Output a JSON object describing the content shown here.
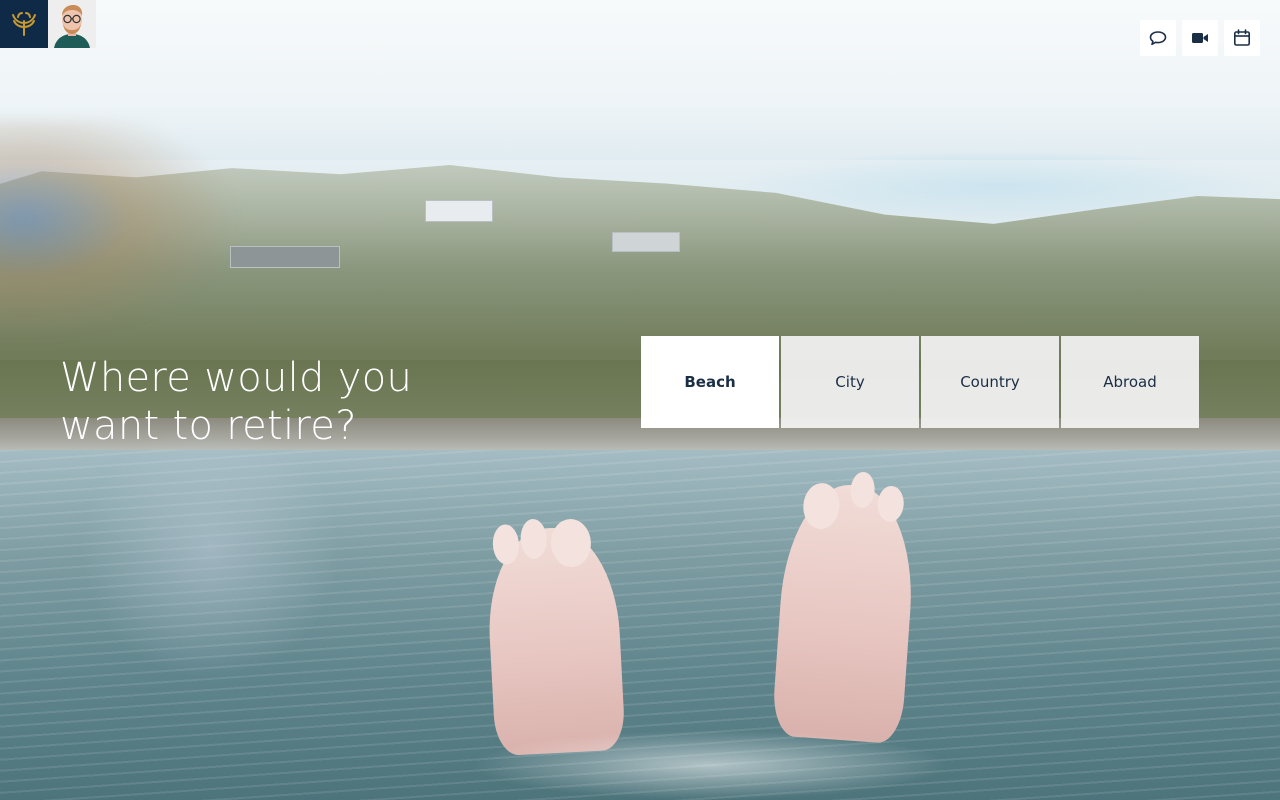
{
  "header": {
    "logo_icon": "laurel-crest-icon",
    "avatar_icon": "user-portrait-icon",
    "actions": [
      {
        "icon": "chat-bubble-icon",
        "name": "chat"
      },
      {
        "icon": "video-camera-icon",
        "name": "video-call"
      },
      {
        "icon": "calendar-icon",
        "name": "schedule"
      }
    ]
  },
  "main": {
    "question": "Where would you want to retire?",
    "options": [
      {
        "label": "Beach",
        "selected": true
      },
      {
        "label": "City",
        "selected": false
      },
      {
        "label": "Country",
        "selected": false
      },
      {
        "label": "Abroad",
        "selected": false
      }
    ]
  },
  "colors": {
    "brand_navy": "#0f2a47",
    "brand_gold": "#c99a2e",
    "option_text": "#1a2e45",
    "option_bg": "#f4f4f4",
    "option_selected_bg": "#ffffff"
  }
}
